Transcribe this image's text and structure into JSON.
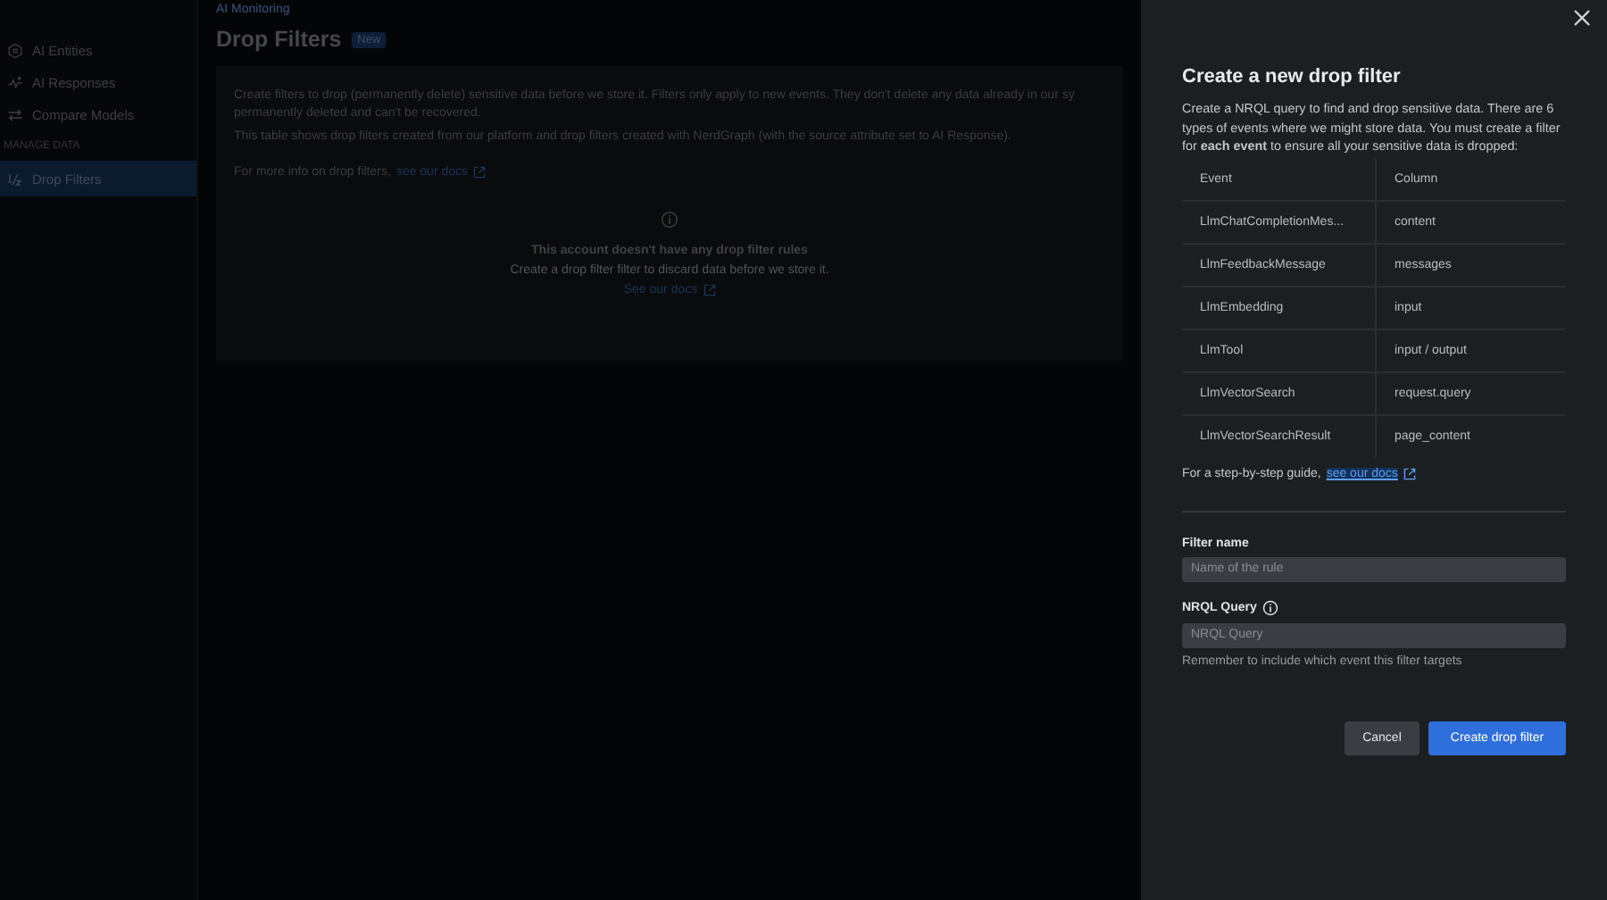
{
  "sidebar": {
    "items": [
      {
        "label": "AI Entities",
        "kind": "entities",
        "selected": false
      },
      {
        "label": "AI Responses",
        "kind": "responses",
        "selected": false
      },
      {
        "label": "Compare Models",
        "kind": "compare",
        "selected": false
      }
    ],
    "section": "MANAGE DATA",
    "section_items": [
      {
        "label": "Drop Filters",
        "kind": "filters",
        "selected": true
      }
    ]
  },
  "breadcrumb": "AI Monitoring",
  "page": {
    "title": "Drop Filters",
    "badge": "New",
    "intro_lines": [
      "Create filters to drop (permanently delete) sensitive data before we store it. Filters only apply to new events. They don't delete any data already in our sy",
      "permanently deleted and can't be recovered."
    ],
    "table_note": "This table shows drop filters created from our platform and drop filters created with NerdGraph (with the source attribute set to AI Response).",
    "docs_text": "For more info on drop filters,",
    "docs_link": "see our docs",
    "empty_title": "This account doesn't have any drop filter rules",
    "empty_text": "Create a drop filter filter to discard data before we store it.",
    "empty_link": "See our docs"
  },
  "drawer": {
    "title": "Create a new drop filter",
    "description": "Create a NRQL query to find and drop sensitive data. There are 6 types of events where we might store data. You must create a filter for **each event** to ensure all your sensitive data is dropped:",
    "table": {
      "columns": [
        "Event",
        "Column"
      ],
      "rows": [
        [
          "LlmChatCompletionMes...",
          "content"
        ],
        [
          "LlmFeedbackMessage",
          "messages"
        ],
        [
          "LlmEmbedding",
          "input"
        ],
        [
          "LlmTool",
          "input / output"
        ],
        [
          "LlmVectorSearch",
          "request.query"
        ],
        [
          "LlmVectorSearchResult",
          "page_content"
        ]
      ]
    },
    "guide_text": "For a step-by-step guide,",
    "guide_link": "see our docs",
    "fields": [
      {
        "label": "Filter name",
        "placeholder": "Name of the rule",
        "kind": "text"
      },
      {
        "label": "NRQL Query",
        "placeholder": "NRQL Query",
        "kind": "query",
        "help": "Remember to include which event this filter targets"
      }
    ],
    "buttons": [
      {
        "label": "Cancel",
        "kind": "secondary"
      },
      {
        "label": "Create drop filter",
        "kind": "primary"
      }
    ]
  }
}
